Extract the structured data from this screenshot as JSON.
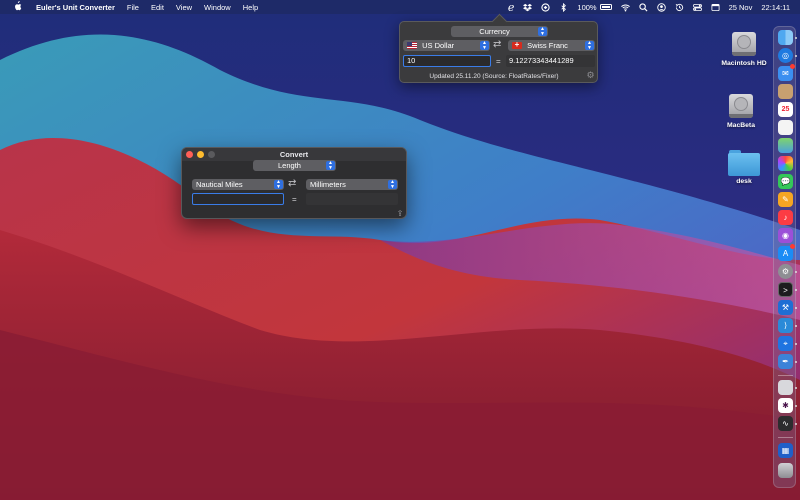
{
  "menubar": {
    "apple_label": "",
    "app_name": "Euler's Unit Converter",
    "menus": [
      "File",
      "Edit",
      "View",
      "Window",
      "Help"
    ],
    "status_icons": [
      "euler-e-icon",
      "dropbox-icon",
      "vpn-icon",
      "bluetooth-icon",
      "battery-icon",
      "wifi-icon",
      "search-icon",
      "user-icon",
      "time-machine-icon",
      "control-center-icon",
      "calendar-menu-icon"
    ],
    "euler_glyph": "e",
    "battery_percent": "100%",
    "date": "25 Nov",
    "time": "22:14:11"
  },
  "currency_popover": {
    "category": "Currency",
    "from_unit": "US Dollar",
    "to_unit": "Swiss Franc",
    "input_value": "10",
    "equals": "=",
    "result_value": "9.12273343441289",
    "updated_text": "Updated 25.11.20 (Source: FloatRates/Fixer)"
  },
  "convert_window": {
    "title": "Convert",
    "category": "Length",
    "from_unit": "Nautical Miles",
    "to_unit": "Millimeters",
    "input_value": "",
    "equals": "=",
    "result_value": ""
  },
  "desktop": {
    "icons": [
      {
        "label": "Macintosh HD",
        "kind": "hard-drive-icon"
      },
      {
        "label": "MacBeta",
        "kind": "hard-drive-icon"
      },
      {
        "label": "desk",
        "kind": "folder-icon"
      }
    ]
  },
  "dock": {
    "calendar_day": "25",
    "apps": [
      "finder",
      "safari",
      "mail",
      "contacts",
      "calendar",
      "reminders",
      "maps",
      "photos",
      "messages",
      "pages",
      "music",
      "podcasts",
      "app-store",
      "system-preferences",
      "terminal",
      "xcode",
      "vscode",
      "maps-pin",
      "script-editor",
      "preview",
      "slack",
      "activity-monitor",
      "app-switcher",
      "trash"
    ]
  },
  "colors": {
    "accent": "#2f6fe0",
    "popover_bg": "#3b3b3d",
    "window_bg": "#2e2e30"
  }
}
